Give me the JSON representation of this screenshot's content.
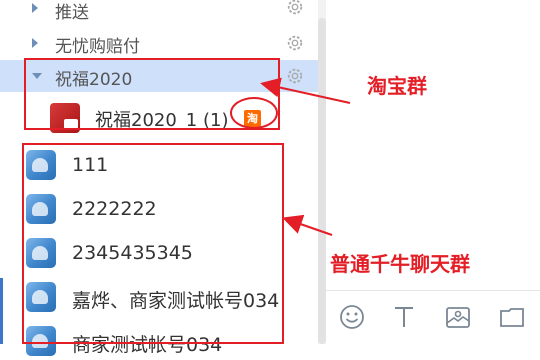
{
  "list": {
    "rows": [
      {
        "label": "推送",
        "expanded": false
      },
      {
        "label": "无忧购赔付",
        "expanded": false
      },
      {
        "label": "祝福2020",
        "expanded": true
      }
    ],
    "taobao_group": {
      "label": "祝福2020_1 (1)",
      "badge": "淘"
    },
    "groups": [
      {
        "label": "111"
      },
      {
        "label": "2222222"
      },
      {
        "label": "2345435345"
      },
      {
        "label": "嘉烨、商家测试帐号034"
      },
      {
        "label": "商家测试帐号034"
      }
    ]
  },
  "annotations": {
    "taobao": "淘宝群",
    "normal": "普通千牛聊天群"
  },
  "toolbar": {
    "icons": [
      "smile-icon",
      "text-icon",
      "image-icon",
      "folder-icon"
    ]
  },
  "colors": {
    "selected_row": "#cfe0fb",
    "annotation_red": "#e41e26",
    "badge_orange": "#ff6a00"
  }
}
